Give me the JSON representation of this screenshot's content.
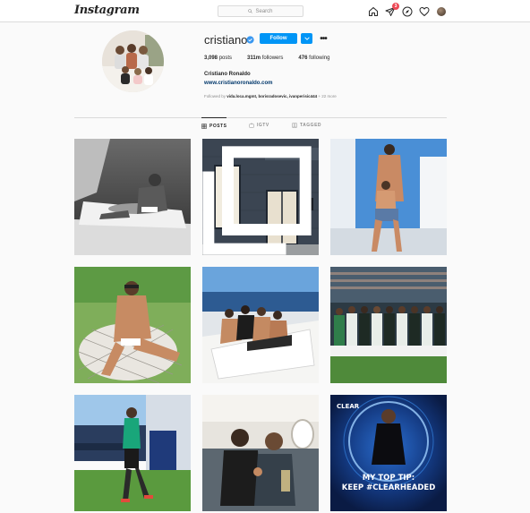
{
  "topbar": {
    "logo": "Instagram",
    "search_placeholder": "Search",
    "activity_badge": "3"
  },
  "profile": {
    "username": "cristiano",
    "follow_label": "Follow",
    "posts_count": "3,098",
    "posts_label": "posts",
    "followers_count": "311m",
    "followers_label": "followers",
    "following_count": "476",
    "following_label": "following",
    "full_name": "Cristiano Ronaldo",
    "website": "www.cristianoronaldo.com",
    "followed_by_prefix": "Followed by",
    "followed_by_users": "vida.loca.mgmt, borisradosevic, ivanperisic444",
    "followed_by_more": "+ 22 more"
  },
  "tabs": [
    {
      "label": "POSTS",
      "icon": "grid-icon",
      "active": true
    },
    {
      "label": "IGTV",
      "icon": "igtv-icon",
      "active": false
    },
    {
      "label": "TAGGED",
      "icon": "tag-icon",
      "active": false
    }
  ],
  "posts": [
    {
      "subject": "bw-boat-lounging",
      "badge": "none"
    },
    {
      "subject": "storefront-building",
      "badge": "multiple"
    },
    {
      "subject": "yacht-with-son",
      "badge": "none"
    },
    {
      "subject": "sunbathing-lounger",
      "badge": "none"
    },
    {
      "subject": "family-on-boat",
      "badge": "none"
    },
    {
      "subject": "team-photo-pitch",
      "badge": "none"
    },
    {
      "subject": "training-ground",
      "badge": "none"
    },
    {
      "subject": "private-jet-selfie",
      "badge": "none"
    },
    {
      "subject": "clear-shampoo-ad",
      "badge": "none",
      "brand": "CLEAR",
      "line1": "MY TOP TIP:",
      "line2": "KEEP #CLEARHEADED"
    }
  ],
  "colors": {
    "accent": "#0095f6",
    "badge": "#ed4956",
    "link": "#00376b",
    "verified": "#3897f0"
  }
}
